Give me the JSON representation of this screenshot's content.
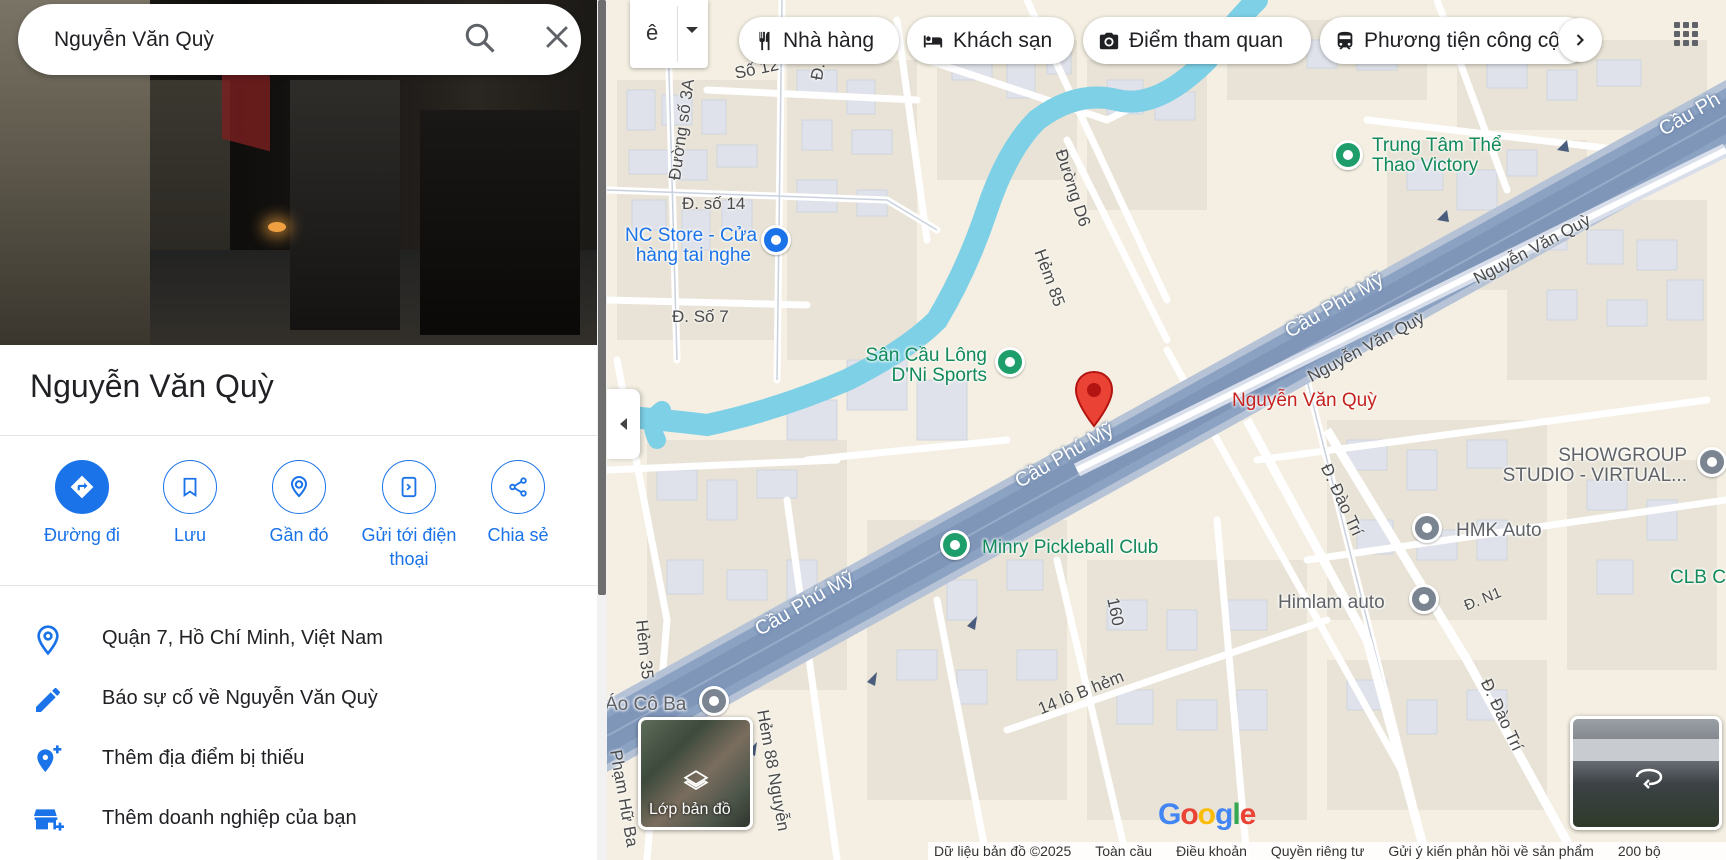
{
  "search": {
    "value": "Nguyễn Văn Quỳ"
  },
  "place": {
    "title": "Nguyễn Văn Quỳ",
    "actions": [
      {
        "label": "Đường đi",
        "icon": "directions-icon"
      },
      {
        "label": "Lưu",
        "icon": "bookmark-icon"
      },
      {
        "label": "Gần đó",
        "icon": "nearby-icon"
      },
      {
        "label": "Gửi tới điện thoại",
        "icon": "send-to-phone-icon"
      },
      {
        "label": "Chia sẻ",
        "icon": "share-icon"
      }
    ],
    "info": [
      {
        "text": "Quận 7, Hồ Chí Minh, Việt Nam",
        "icon": "location-pin-icon"
      },
      {
        "text": "Báo sự cố về Nguyễn Văn Quỳ",
        "icon": "pencil-icon"
      },
      {
        "text": "Thêm địa điểm bị thiếu",
        "icon": "add-place-icon"
      },
      {
        "text": "Thêm doanh nghiệp của bạn",
        "icon": "add-business-icon"
      }
    ]
  },
  "map": {
    "input_tool_glyph": "ê",
    "chips": [
      {
        "label": "Nhà hàng",
        "icon": "restaurant-icon"
      },
      {
        "label": "Khách sạn",
        "icon": "hotel-icon"
      },
      {
        "label": "Điểm tham quan",
        "icon": "camera-icon"
      },
      {
        "label": "Phương tiện công cộng",
        "icon": "transit-icon"
      }
    ],
    "pois": {
      "trung_tam": "Trung Tâm Thể\nThao Victory",
      "nc_store": "NC Store - Cửa\nhàng tai nghe",
      "san_cau_long": "Sân Cầu Lông\nD'Ni Sports",
      "selected": "Nguyễn Văn Quỳ",
      "showgroup": "SHOWGROUP\nSTUDIO - VIRTUAL...",
      "hmk": "HMK Auto",
      "himlam": "Himlam auto",
      "clb": "CLB Cầu L",
      "minry": "Minry Pickleball Club",
      "ao_co_ba": "Áo Cô Ba"
    },
    "roads": {
      "so7a": "Đ. Số 7",
      "so12": "Số 12",
      "duong3a": "Đường số 3A",
      "so14": "Đ. số 14",
      "so7": "Đ. Số 7",
      "d6": "Đường D6",
      "hem85": "Hẻm 85",
      "cau_phu_my_1": "Cầu Phú Mỹ",
      "cau_phu_my_2": "Cầu Phú Mỹ",
      "cau_phu_my_3": "Cầu Phú Mỹ",
      "cau_ph": "Cầu Ph",
      "nvq1": "Nguyễn Văn Quỳ",
      "nvq2": "Nguyễn Văn Quỳ",
      "dao_tri1": "Đ. Đào Trí",
      "dao_tri2": "Đ. Đào Trí",
      "n1": "Đ. N1",
      "hem35": "Hẻm 35",
      "r160": "160",
      "lo14b": "14 lô B hẻm",
      "hem88": "Hẻm 88 Nguyễn",
      "pham_hu": "Phạm Hữ Ba"
    },
    "layer_label": "Lớp bản đồ",
    "logo": [
      "G",
      "o",
      "o",
      "g",
      "l",
      "e"
    ],
    "footer": {
      "data": "Dữ liệu bản đồ ©2025",
      "global": "Toàn cầu",
      "terms": "Điều khoản",
      "privacy": "Quyền riêng tư",
      "feedback": "Gửi ý kiến phản hồi về sản phẩm",
      "scale": "200 bộ"
    }
  }
}
